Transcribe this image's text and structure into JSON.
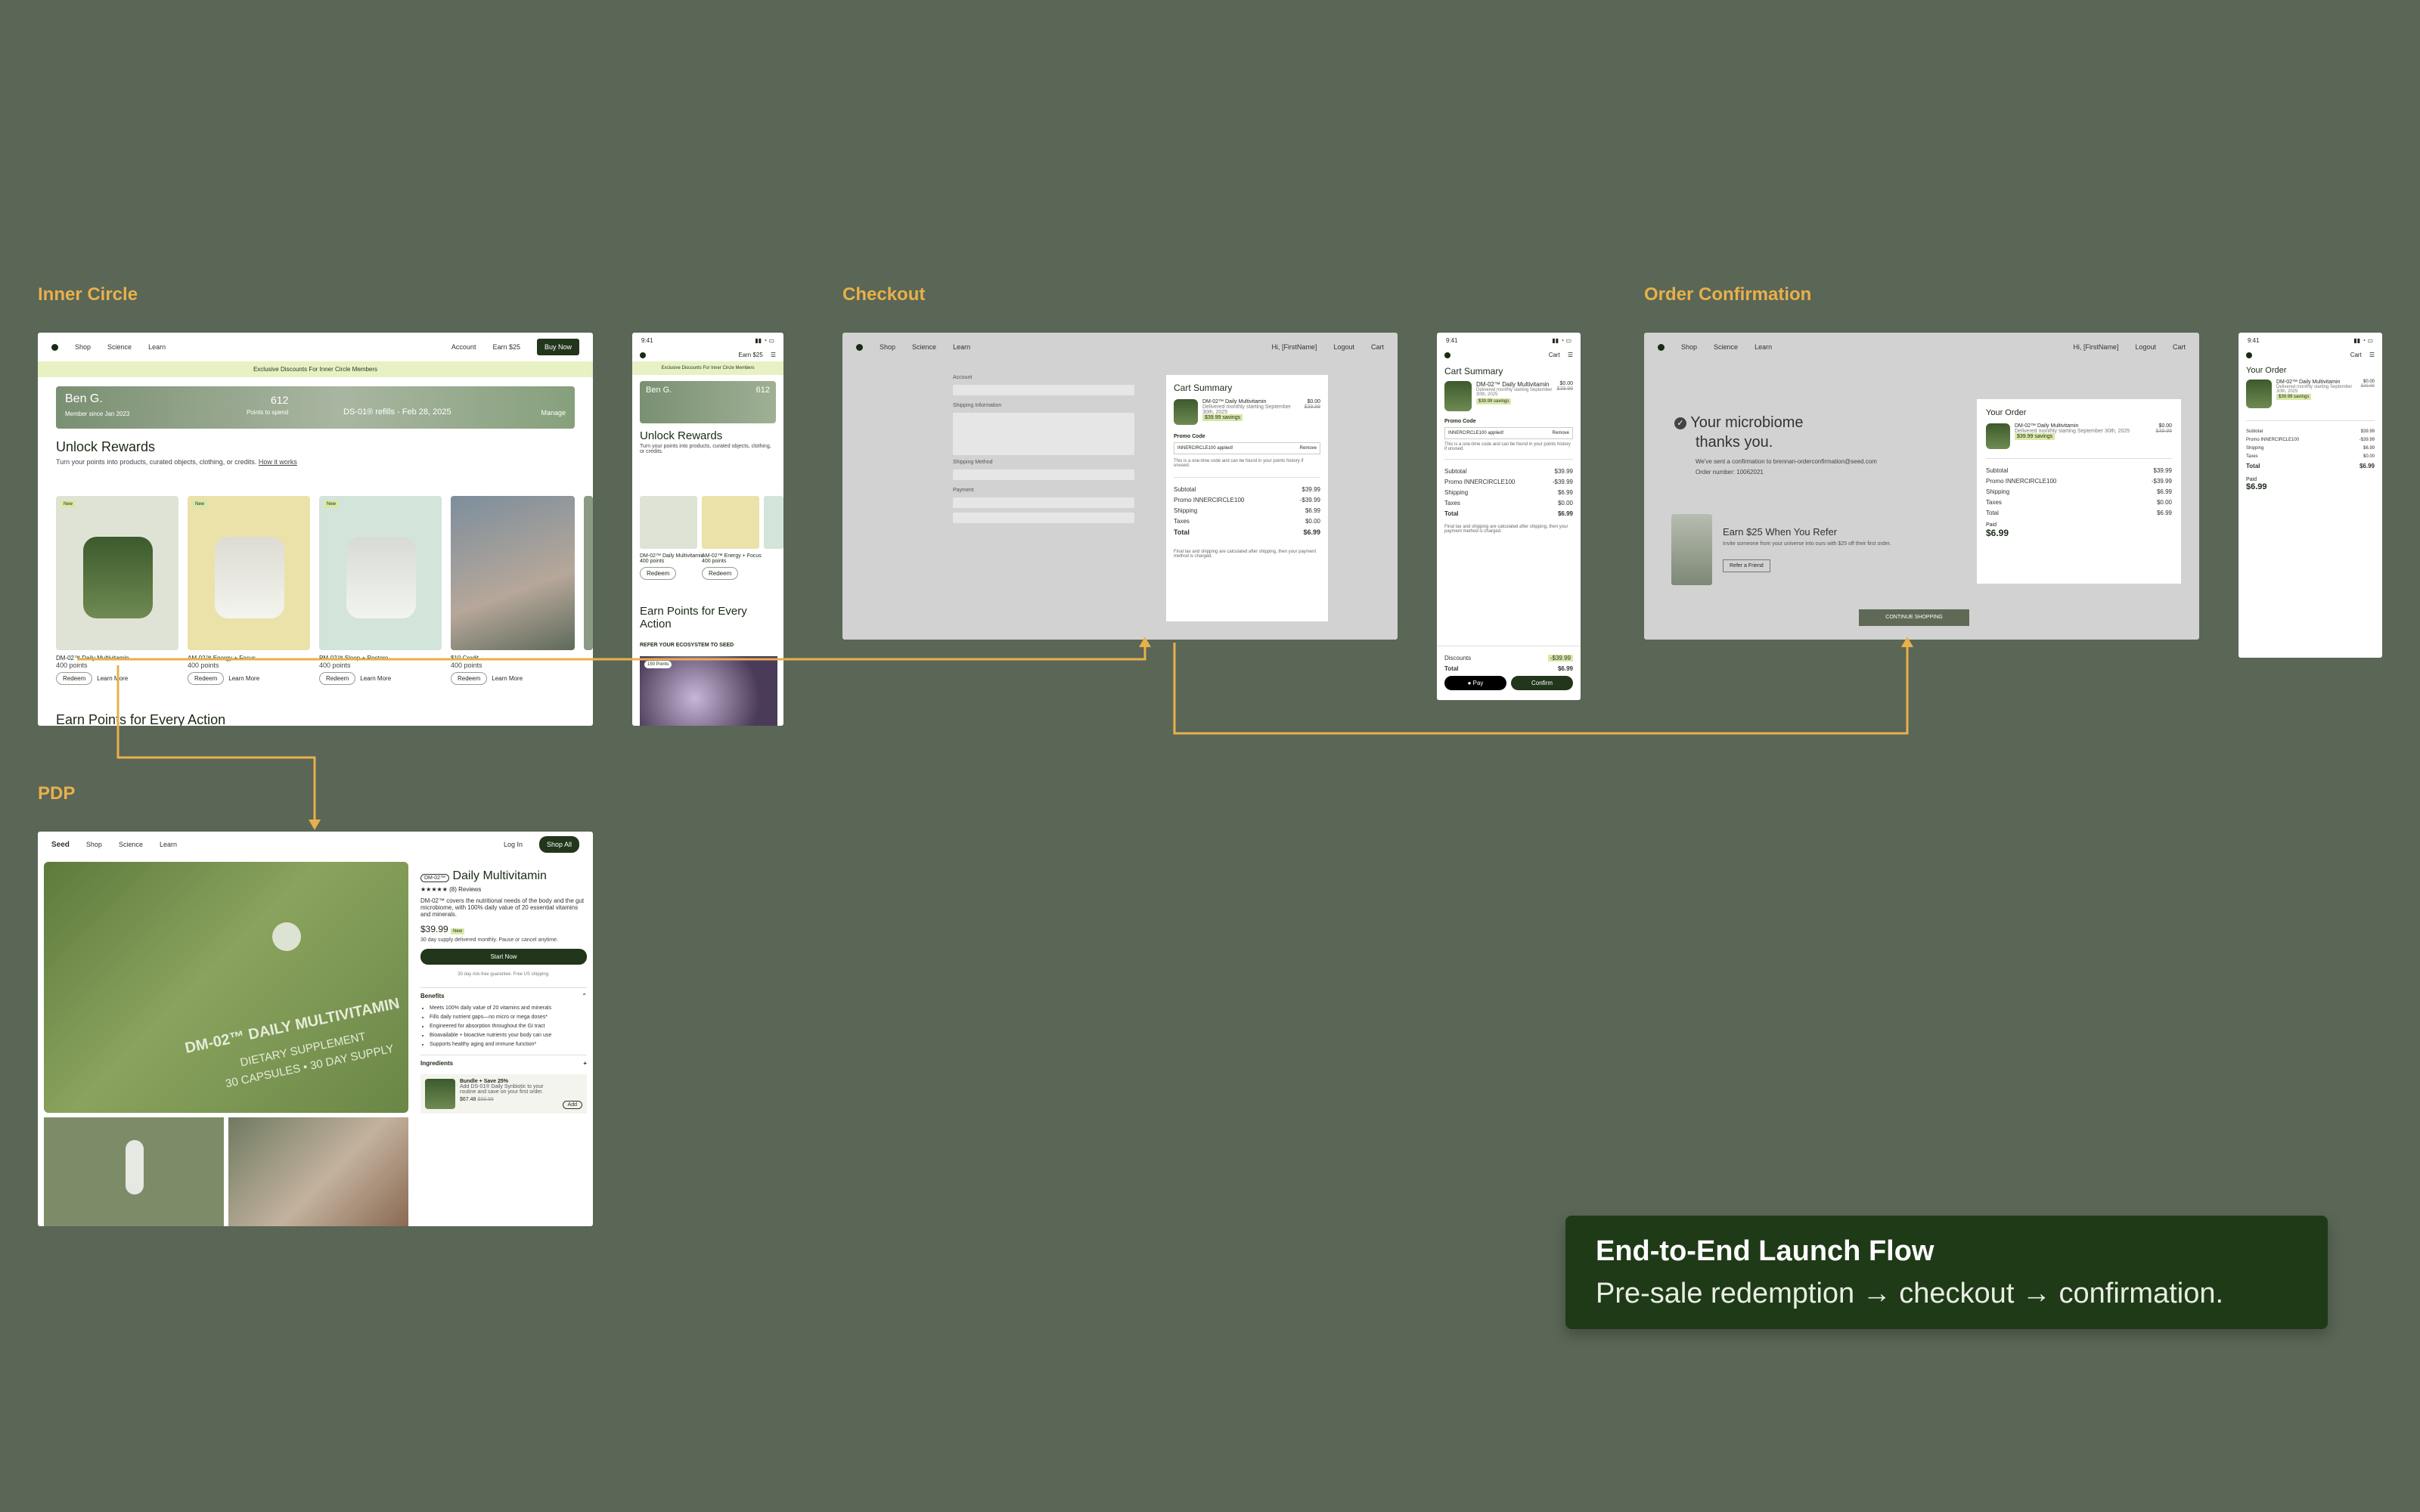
{
  "sections": {
    "inner_circle": "Inner Circle",
    "checkout": "Checkout",
    "order_confirmation": "Order Confirmation",
    "pdp": "PDP"
  },
  "nav": {
    "shop": "Shop",
    "science": "Science",
    "learn": "Learn",
    "account": "Account",
    "earn": "Earn $25",
    "buy_now": "Buy Now",
    "greeting": "Hi, [FirstName]",
    "logout": "Logout",
    "cart": "Cart",
    "log_in": "Log In",
    "shop_all": "Shop All"
  },
  "inner_circle": {
    "banner": "Exclusive Discounts For Inner Circle Members",
    "member_name": "Ben G.",
    "member_since": "Member since Jan 2023",
    "points": "612",
    "points_label": "Points to spend",
    "next_refill": "DS-01® refills - Feb 28, 2025",
    "manage": "Manage",
    "unlock_title": "Unlock Rewards",
    "unlock_desc": "Turn your points into products, curated objects, clothing, or credits.",
    "how_it_works": "How it works",
    "new_badge": "New",
    "rewards": [
      {
        "name": "DM-02™ Daily Multivitamin",
        "points": "400 points"
      },
      {
        "name": "AM-02™ Energy + Focus",
        "points": "400 points"
      },
      {
        "name": "PM-02™ Sleep + Restore",
        "points": "400 points"
      },
      {
        "name": "$10 Credit",
        "points": "400 points"
      }
    ],
    "redeem": "Redeem",
    "learn_more": "Learn More",
    "earn_title": "Earn Points for Every Action",
    "refer_label": "REFER YOUR ECOSYSTEM TO SEED"
  },
  "mobile": {
    "time": "9:41",
    "earn": "Earn $25",
    "cart_summary": "Cart Summary",
    "your_order": "Your Order",
    "product_name": "DM-02™ Daily Multivitamin",
    "delivery": "Delivered monthly starting September 30th, 2025",
    "savings": "$39.99 savings",
    "price_now": "$0.00",
    "price_was": "$39.99",
    "promo_code_label": "Promo Code",
    "promo_code": "INNERCIRCLE100 applied!",
    "remove": "Remove",
    "discounts": "Discounts",
    "discount_value": "-$39.99",
    "total": "Total",
    "total_value": "$6.99",
    "apple_pay": "Pay",
    "confirm": "Confirm",
    "paid": "Paid",
    "paid_value": "$6.99",
    "unlock_title": "Unlock Rewards",
    "earn_title": "Earn Points for Every Action",
    "points_badge": "150 Points"
  },
  "checkout": {
    "account": "Account",
    "shipping_information": "Shipping Information",
    "ship_to": "Ship To",
    "shipping_method": "Shipping Method",
    "payment": "Payment",
    "summary_title": "Cart Summary",
    "note": "This is a one-time code and can be found in your points history if unused.",
    "rows": [
      {
        "label": "Subtotal",
        "value": "$39.99"
      },
      {
        "label": "Promo INNERCIRCLE100",
        "value": "-$39.99"
      },
      {
        "label": "Shipping",
        "value": "$6.99"
      },
      {
        "label": "Taxes",
        "value": "$0.00"
      }
    ],
    "total": "Total",
    "total_value": "$6.99",
    "final_note": "Final tax and shipping are calculated after shipping, then your payment method is charged."
  },
  "confirmation": {
    "title_1": "Your microbiome",
    "title_2": "thanks you.",
    "sent_to": "We've sent a confirmation to brennan-orderconfirmation@seed.com",
    "order_number": "Order number: 10062021",
    "refer_title": "Earn $25 When You Refer",
    "refer_desc": "Invite someone from your universe into ours with $25 off their first order.",
    "refer_button": "Refer a Friend",
    "order_title": "Your Order",
    "rows": [
      {
        "label": "Subtotal",
        "value": "$39.99"
      },
      {
        "label": "Promo INNERCIRCLE100",
        "value": "-$39.99"
      },
      {
        "label": "Shipping",
        "value": "$6.99"
      },
      {
        "label": "Taxes",
        "value": "$0.00"
      }
    ],
    "total": "Total",
    "total_value": "$6.99",
    "paid": "Paid",
    "paid_value": "$6.99",
    "continue": "CONTINUE SHOPPING"
  },
  "pdp": {
    "logo": "Seed",
    "badge": "DM-02™",
    "title": "Daily Multivitamin",
    "stars": "★★★★★",
    "reviews": "(8) Reviews",
    "desc": "DM-02™ covers the nutritional needs of the body and the gut microbiome, with 100% daily value of 20 essential vitamins and minerals.",
    "price": "$39.99",
    "new_badge": "New",
    "supply": "30 day supply delivered monthly. Pause or cancel anytime.",
    "cta": "Start Now",
    "guarantee": "30 day risk-free guarantee. Free US shipping.",
    "benefits_title": "Benefits",
    "benefits": [
      "Meets 100% daily value of 20 vitamins and minerals",
      "Fills daily nutrient gaps—no micro or mega doses*",
      "Engineered for absorption throughout the GI tract",
      "Bioavailable + bioactive nutrients your body can use",
      "Supports healthy aging and immune function*"
    ],
    "ingredients": "Ingredients",
    "bundle_title": "Bundle + Save 25%",
    "bundle_desc": "Add DS-01® Daily Synbiotic to your routine and save on your first order.",
    "bundle_price": "$67.48",
    "bundle_was": "$89.98",
    "add": "Add",
    "jar_line_1": "DM-02™ DAILY MULTIVITAMIN",
    "jar_line_2": "DIETARY SUPPLEMENT",
    "jar_line_3": "30 CAPSULES • 30 DAY SUPPLY"
  },
  "callout": {
    "title": "End-to-End Launch Flow",
    "subtitle": "Pre-sale redemption → checkout → confirmation."
  },
  "colors": {
    "background": "#5a6656",
    "accent_label": "#e8b04b",
    "brand_dark": "#21361b",
    "flow_line": "#e8b04b"
  }
}
